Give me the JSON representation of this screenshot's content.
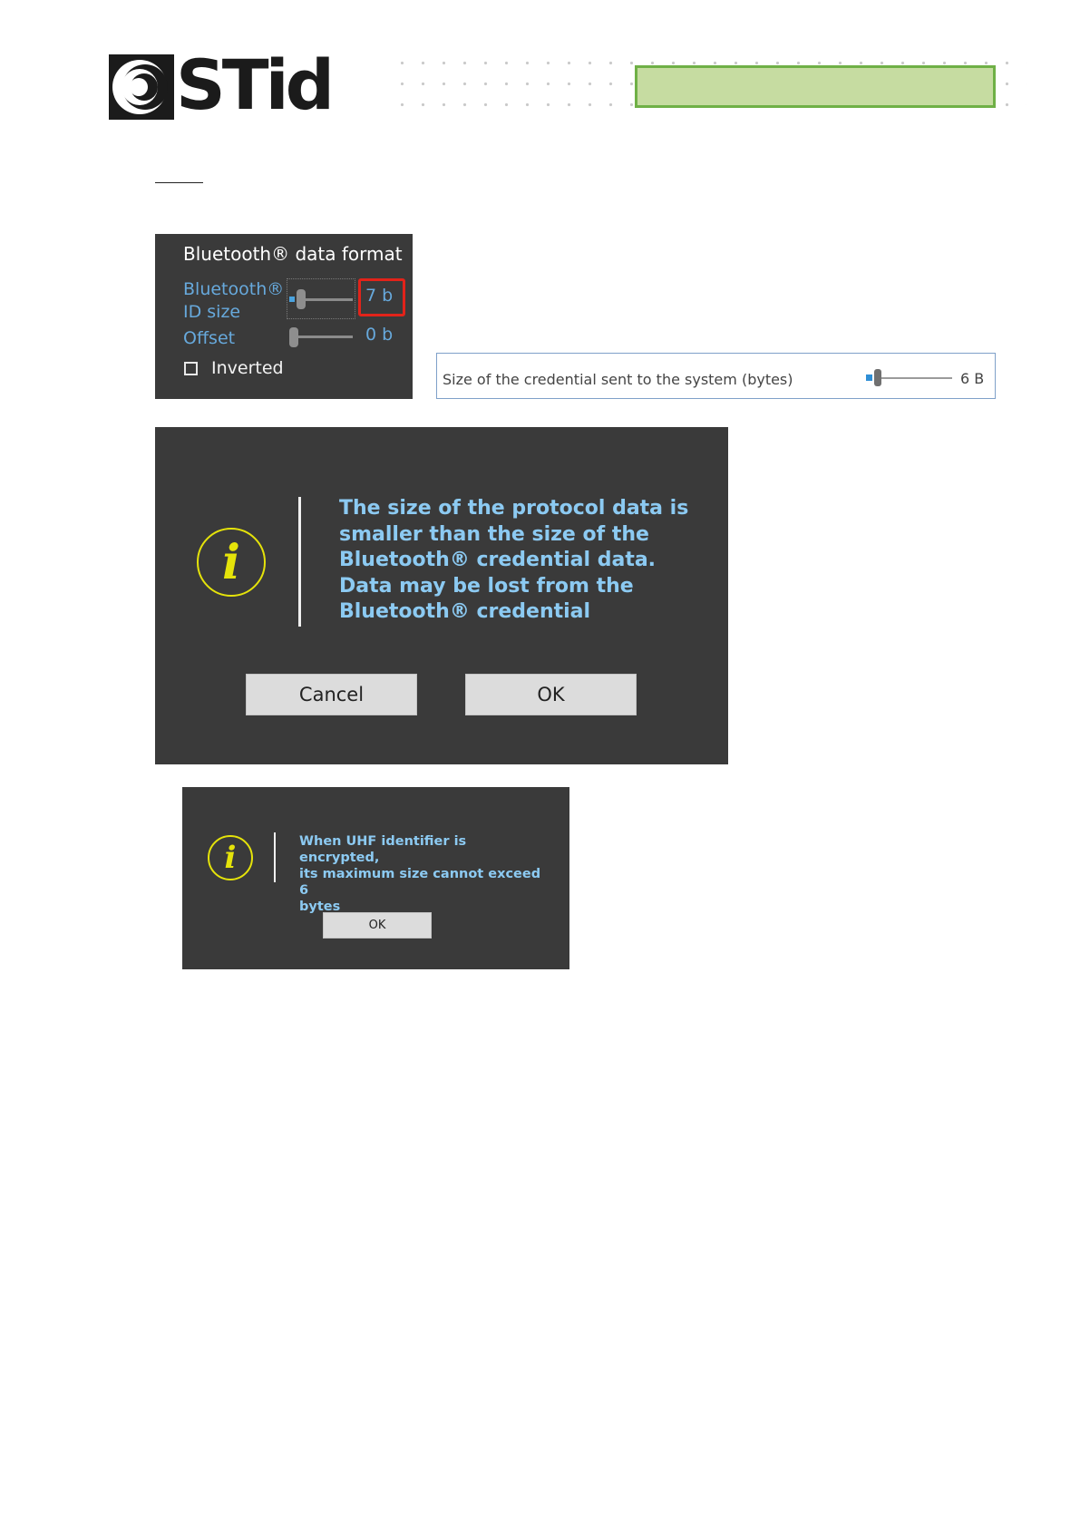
{
  "header": {
    "logo_text": "STid"
  },
  "bluetooth_panel": {
    "title": "Bluetooth® data format",
    "id_size_label_line1": "Bluetooth®",
    "id_size_label_line2": "ID size",
    "id_size_value": "7 b",
    "offset_label": "Offset",
    "offset_value": "0 b",
    "inverted_label": "Inverted",
    "inverted_checked": false
  },
  "credential_size": {
    "label": "Size of the credential sent to the system (bytes)",
    "value": "6 B"
  },
  "dialog_protocol": {
    "icon": "info-icon",
    "message_lines": [
      "The size of the protocol data is",
      "smaller than the size of the",
      "Bluetooth® credential data.",
      "Data may be lost from the",
      "Bluetooth® credential"
    ],
    "cancel_label": "Cancel",
    "ok_label": "OK"
  },
  "dialog_uhf": {
    "icon": "info-icon",
    "message_lines": [
      "When UHF identifier is encrypted,",
      "its maximum size cannot exceed 6",
      "bytes"
    ],
    "ok_label": "OK"
  },
  "colors": {
    "panel_bg": "#3a3a3a",
    "label_blue": "#67a9dc",
    "message_blue": "#8ccaf2",
    "icon_yellow": "#e5e30a",
    "highlight_red": "#e2231a",
    "header_green": "#c6dca1"
  }
}
